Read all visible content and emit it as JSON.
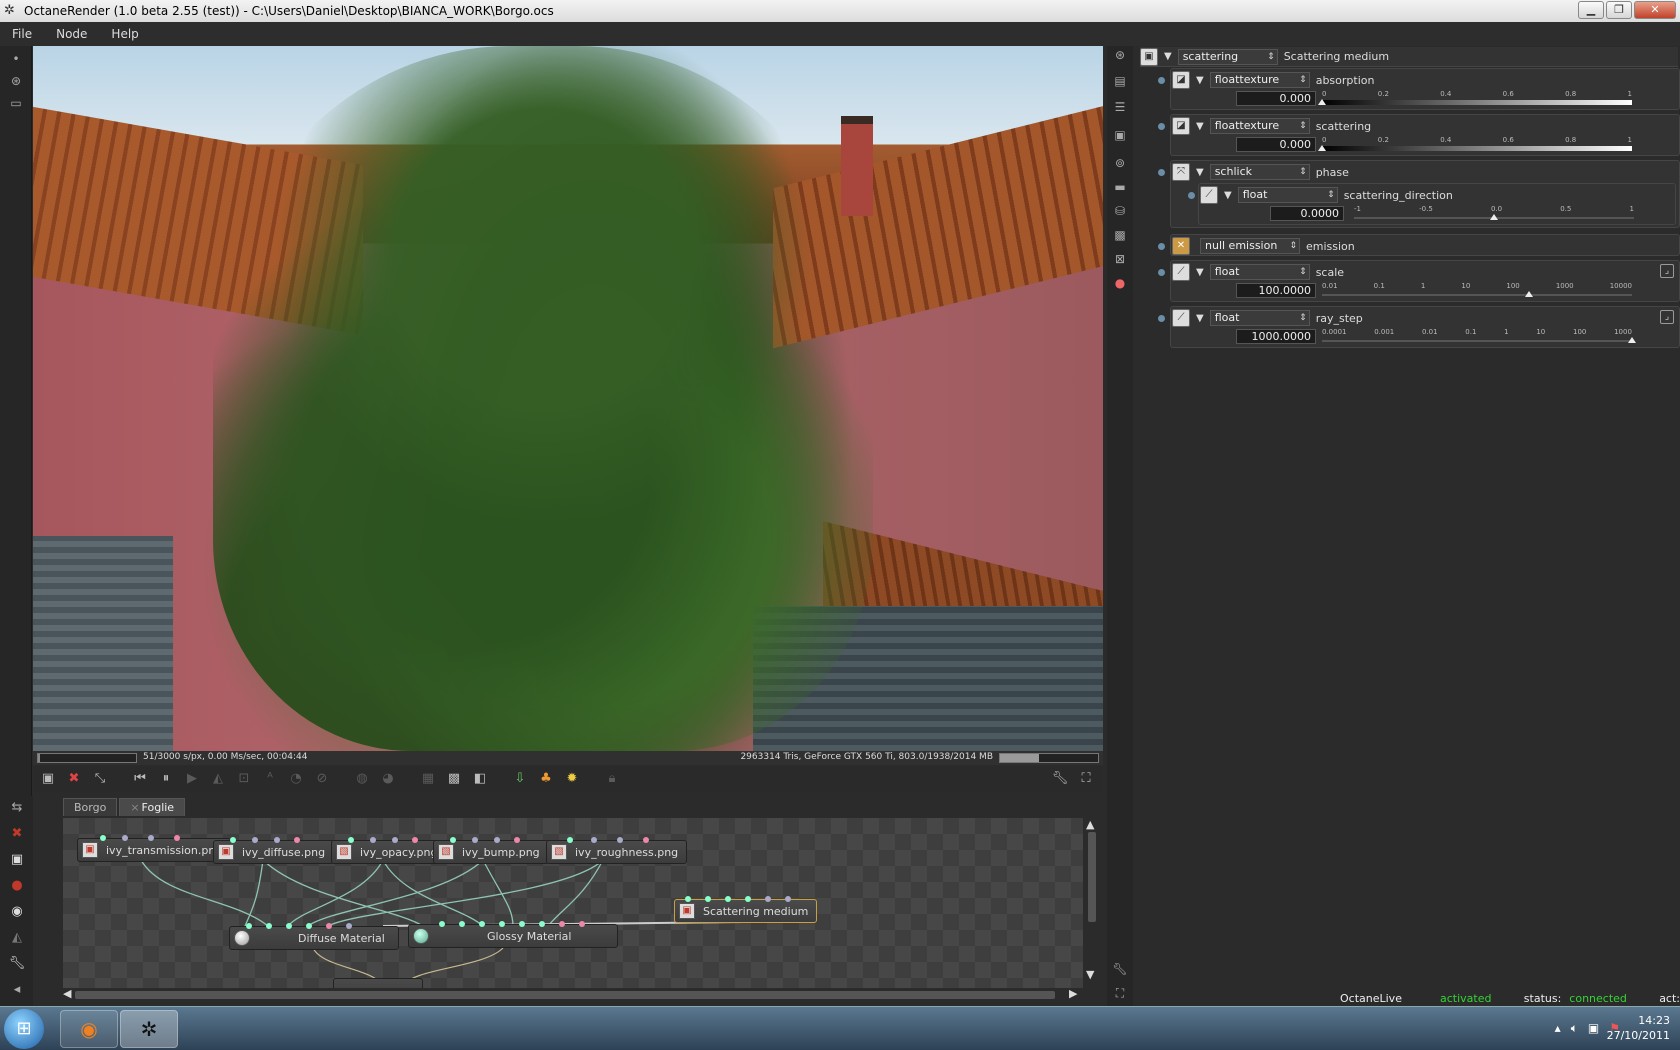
{
  "window": {
    "title": "OctaneRender (1.0 beta 2.55 (test)) - C:\\Users\\Daniel\\Desktop\\BIANCA_WORK\\Borgo.ocs",
    "minimize": "▁",
    "maximize": "❐",
    "close": "✕"
  },
  "menu": {
    "file": "File",
    "node": "Node",
    "help": "Help"
  },
  "render_status": {
    "samples_text": "51/3000 s/px, 0.00 Ms/sec, 00:04:44",
    "gpu_text": "2963314 Tris, GeForce GTX 560 Ti, 803.0/1938/2014 MB",
    "progress": 0.017,
    "memory_fraction": 0.4
  },
  "graph": {
    "tabs": [
      {
        "label": "Borgo"
      },
      {
        "label": "Foglie",
        "close": "×"
      }
    ],
    "nodes": {
      "transmission": "ivy_transmission.png",
      "diffuse_tex": "ivy_diffuse.png",
      "opacity": "ivy_opacy.png",
      "bump": "ivy_bump.png",
      "roughness": "ivy_roughness.png",
      "scattering": "Scattering medium",
      "diffuse_mat": "Diffuse Material",
      "glossy_mat": "Glossy Material"
    }
  },
  "inspector": {
    "root": {
      "type": "scattering",
      "label": "Scattering medium"
    },
    "absorption": {
      "type": "floattexture",
      "label": "absorption",
      "value": "0.000",
      "ticks": [
        "0",
        "0.2",
        "0.4",
        "0.6",
        "0.8",
        "1"
      ],
      "fraction": 0.0
    },
    "scattering": {
      "type": "floattexture",
      "label": "scattering",
      "value": "0.000",
      "ticks": [
        "0",
        "0.2",
        "0.4",
        "0.6",
        "0.8",
        "1"
      ],
      "fraction": 0.0
    },
    "phase": {
      "type": "schlick",
      "label": "phase"
    },
    "scattering_direction": {
      "type": "float",
      "label": "scattering_direction",
      "value": "0.0000",
      "ticks": [
        "-1",
        "-0.5",
        "0.0",
        "0.5",
        "1"
      ],
      "fraction": 0.5
    },
    "emission": {
      "type": "null emission",
      "label": "emission"
    },
    "scale": {
      "type": "float",
      "label": "scale",
      "value": "100.0000",
      "ticks": [
        "0.01",
        "0.1",
        "1",
        "10",
        "100",
        "1000",
        "10000"
      ],
      "fraction": 0.667
    },
    "ray_step": {
      "type": "float",
      "label": "ray_step",
      "value": "1000.0000",
      "ticks": [
        "0.0001",
        "0.001",
        "0.01",
        "0.1",
        "1",
        "10",
        "100",
        "1000"
      ],
      "fraction": 1.0
    }
  },
  "live": {
    "account_label": "OctaneLive account:",
    "account_value": "activated",
    "status_label": "status:",
    "status_value": "connected",
    "act_label": "act:"
  },
  "taskbar": {
    "time": "14:23",
    "date": "27/10/2011"
  }
}
